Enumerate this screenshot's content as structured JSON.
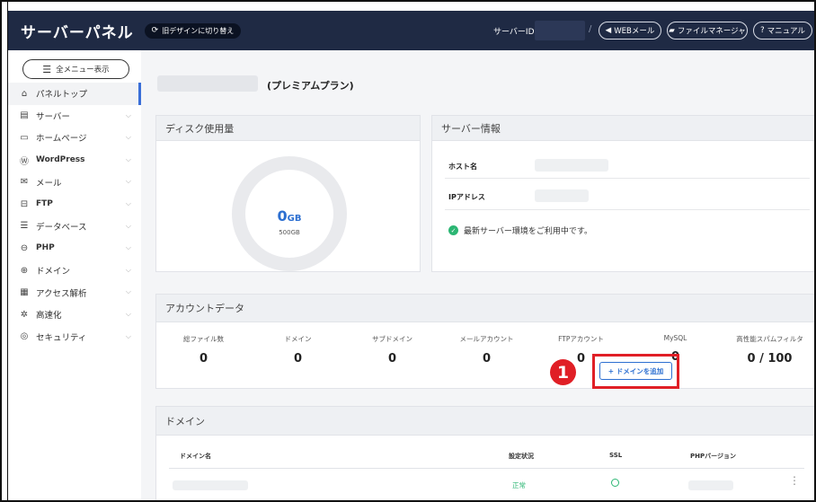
{
  "header": {
    "brand": "サーバーパネル",
    "old_design_label": "旧デザインに切り替え",
    "server_id_label": "サーバーID",
    "slash": "/",
    "buttons": {
      "web_mail": "WEBメール",
      "file_manager": "ファイルマネージャ",
      "manual": "マニュアル"
    }
  },
  "sidebar": {
    "menu_toggle": "全メニュー表示",
    "items": [
      {
        "label": "パネルトップ",
        "icon": "home-icon",
        "glyph": "⌂",
        "active": true
      },
      {
        "label": "サーバー",
        "icon": "server-icon",
        "glyph": "▤"
      },
      {
        "label": "ホームページ",
        "icon": "window-icon",
        "glyph": "▭"
      },
      {
        "label": "WordPress",
        "icon": "wordpress-icon",
        "glyph": "Ⓦ"
      },
      {
        "label": "メール",
        "icon": "mail-icon",
        "glyph": "✉"
      },
      {
        "label": "FTP",
        "icon": "ftp-icon",
        "glyph": "⊟"
      },
      {
        "label": "データベース",
        "icon": "database-icon",
        "glyph": "☰"
      },
      {
        "label": "PHP",
        "icon": "php-icon",
        "glyph": "⊖"
      },
      {
        "label": "ドメイン",
        "icon": "globe-icon",
        "glyph": "⊕"
      },
      {
        "label": "アクセス解析",
        "icon": "chart-icon",
        "glyph": "▦"
      },
      {
        "label": "高速化",
        "icon": "speed-icon",
        "glyph": "✲"
      },
      {
        "label": "セキュリティ",
        "icon": "shield-icon",
        "glyph": "◎"
      }
    ]
  },
  "main": {
    "plan_label": "(プレミアムプラン)",
    "disk": {
      "title": "ディスク使用量",
      "used_value": "0",
      "used_unit": "GB",
      "max": "500GB",
      "used_fraction": 0
    },
    "server_info": {
      "title": "サーバー情報",
      "host_label": "ホスト名",
      "ip_label": "IPアドレス",
      "status": "最新サーバー環境をご利用中です。"
    },
    "account": {
      "title": "アカウントデータ",
      "stats": [
        {
          "label": "総ファイル数",
          "value": "0"
        },
        {
          "label": "ドメイン",
          "value": "0"
        },
        {
          "label": "サブドメイン",
          "value": "0"
        },
        {
          "label": "メールアカウント",
          "value": "0"
        },
        {
          "label": "FTPアカウント",
          "value": "0"
        },
        {
          "label": "MySQL",
          "value": "0"
        },
        {
          "label": "高性能スパムフィルタ",
          "value": "0 / 100"
        }
      ]
    },
    "domain": {
      "title": "ドメイン",
      "add_button": "+ ドメインを追加",
      "step_number": "1",
      "columns": {
        "name": "ドメイン名",
        "status": "設定状況",
        "ssl": "SSL",
        "php": "PHPバージョン"
      },
      "row": {
        "status": "正常"
      }
    }
  }
}
